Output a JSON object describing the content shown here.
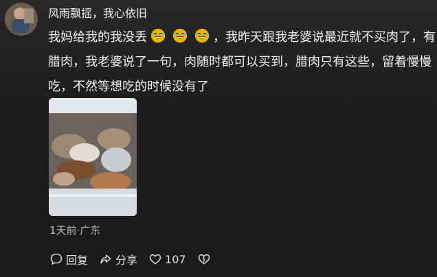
{
  "comment": {
    "username": "风雨飘摇，我心依旧",
    "segments": [
      "我妈给我的我没丢",
      "，我昨天跟我老婆说最近就不买肉了，有腊肉，我老婆说了一句，肉随时都可以买到，腊肉只有这些，留着慢慢吃，不然等想吃的时候没有了"
    ],
    "emoji_icons": [
      "rofl-emoji-icon",
      "rofl-emoji-icon",
      "rofl-emoji-icon"
    ],
    "meta": "1天前·广东"
  },
  "actions": {
    "reply_label": "回复",
    "share_label": "分享",
    "like_count": "107"
  },
  "colors": {
    "background": "#1f1e1f",
    "text": "#f2f2f2",
    "meta": "#bdbdbd",
    "emoji": "#f4b400"
  }
}
